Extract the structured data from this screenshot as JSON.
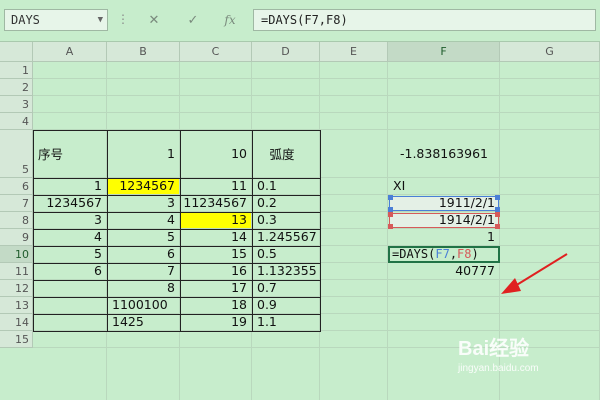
{
  "formula_bar": {
    "name_box": "DAYS",
    "cancel_icon": "close-icon",
    "enter_icon": "check-icon",
    "function_icon": "fx-icon",
    "fx_label": "fx",
    "formula": "=DAYS(F7,F8)"
  },
  "columns": [
    "A",
    "B",
    "C",
    "D",
    "E",
    "F",
    "G"
  ],
  "rows": [
    "1",
    "2",
    "3",
    "4",
    "5",
    "6",
    "7",
    "8",
    "9",
    "10",
    "11",
    "12",
    "13",
    "14",
    "15"
  ],
  "active_column": "F",
  "active_row": "10",
  "cells": {
    "A5": "序号",
    "B5": "1",
    "C5": "10",
    "D5": "弧度",
    "F5": "-1.838163961",
    "A6": "1",
    "B6": "1234567",
    "C6": "11",
    "D6": "0.1",
    "F6": "XI",
    "A7": "1234567",
    "B7": "3",
    "C7": "11234567",
    "D7": "0.2",
    "F7": "1911/2/1",
    "A8": "3",
    "B8": "4",
    "C8": "13",
    "D8": "0.3",
    "F8": "1914/2/1",
    "A9": "4",
    "B9": "5",
    "C9": "14",
    "D9": "1.245567",
    "F9": "1",
    "A10": "5",
    "B10": "6",
    "C10": "15",
    "D10": "0.5",
    "A11": "6",
    "B11": "7",
    "C11": "16",
    "D11": "1.132355",
    "F11": "40777",
    "B12": "8",
    "C12": "17",
    "D12": "0.7",
    "B13": "1100100",
    "C13": "18",
    "D13": "0.9",
    "B14": "1425",
    "C14": "19",
    "D14": "1.1"
  },
  "editing_cell": {
    "ref": "F10",
    "prefix": "=DAYS(",
    "arg1": "F7",
    "sep": ",",
    "arg2": "F8",
    "suffix": ")"
  },
  "colors": {
    "background": "#c7edcc",
    "highlight": "#ffff00",
    "ref1": "#4a7fd6",
    "ref2": "#d65a5a",
    "active_border": "#217346",
    "arrow": "#e02020"
  },
  "watermark": {
    "brand": "Bai经验",
    "url": "jingyan.baidu.com"
  }
}
